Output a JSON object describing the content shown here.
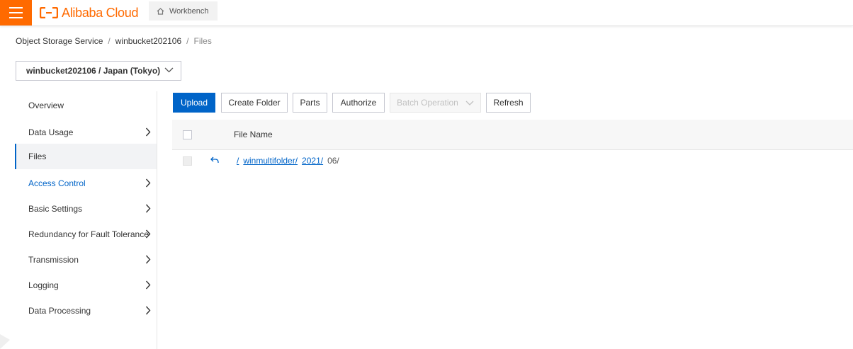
{
  "header": {
    "brand": "Alibaba Cloud",
    "workbench_label": "Workbench",
    "brand_color": "#ff6a00"
  },
  "breadcrumb": {
    "items": [
      "Object Storage Service",
      "winbucket202106",
      "Files"
    ],
    "separator": "/"
  },
  "bucket_selector": {
    "value": "winbucket202106 / Japan (Tokyo)"
  },
  "sidebar": {
    "items": [
      {
        "label": "Overview",
        "has_arrow": false
      },
      {
        "label": "Data Usage",
        "has_arrow": true
      },
      {
        "label": "Files",
        "has_arrow": false,
        "active": true
      },
      {
        "label": "Access Control",
        "has_arrow": true
      },
      {
        "label": "Basic Settings",
        "has_arrow": true
      },
      {
        "label": "Redundancy for Fault Tolerance",
        "has_arrow": true
      },
      {
        "label": "Transmission",
        "has_arrow": true
      },
      {
        "label": "Logging",
        "has_arrow": true
      },
      {
        "label": "Data Processing",
        "has_arrow": true
      }
    ]
  },
  "toolbar": {
    "upload": "Upload",
    "create_folder": "Create Folder",
    "parts": "Parts",
    "authorize": "Authorize",
    "batch_operation": "Batch Operation",
    "refresh": "Refresh"
  },
  "table": {
    "columns": [
      "File Name"
    ],
    "path_row": {
      "segments": [
        "/",
        "winmultifolder/",
        "2021/"
      ],
      "current": "06/"
    }
  },
  "colors": {
    "primary": "#0064c8",
    "accent": "#ff6a00"
  }
}
